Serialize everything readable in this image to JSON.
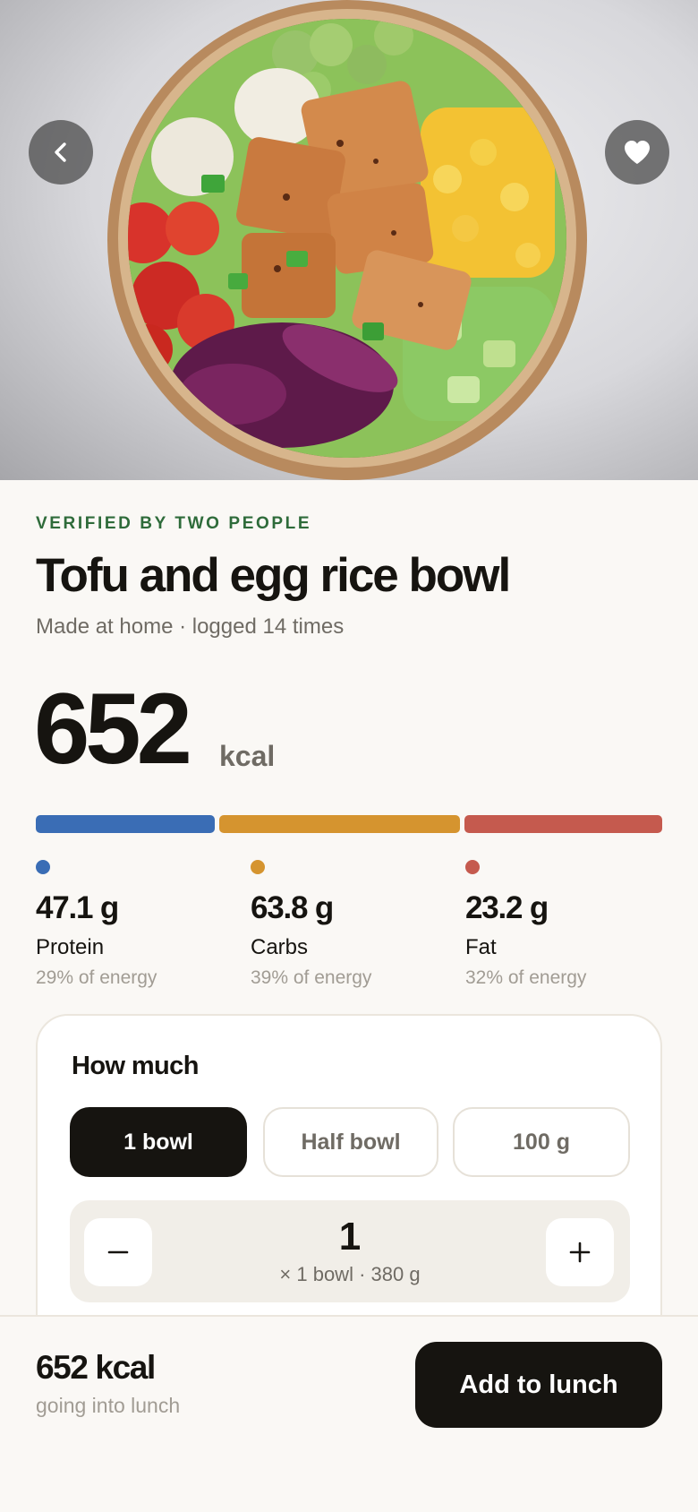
{
  "hero": {
    "photo_icon": "tofu-egg-rice-bowl-photo",
    "back_icon": "chevron-left-icon",
    "favorite_icon": "heart-icon"
  },
  "meal": {
    "verified_label": "VERIFIED BY TWO PEOPLE",
    "title": "Tofu and egg rice bowl",
    "subtitle": "Made at home · logged 14 times",
    "kcal_value": "652",
    "kcal_unit": "kcal"
  },
  "macros": [
    {
      "value": "47.1 g",
      "name": "Protein",
      "energy": "29% of energy",
      "energy_fraction": 0.29,
      "color": "#3a6db5"
    },
    {
      "value": "63.8 g",
      "name": "Carbs",
      "energy": "39% of energy",
      "energy_fraction": 0.39,
      "color": "#d5942f"
    },
    {
      "value": "23.2 g",
      "name": "Fat",
      "energy": "32% of energy",
      "energy_fraction": 0.32,
      "color": "#c55a4e"
    }
  ],
  "portion": {
    "title": "How much",
    "options": [
      "1 bowl",
      "Half bowl",
      "100 g"
    ],
    "selected": "1 bowl",
    "count": "1",
    "detail": "× 1 bowl · 380 g",
    "minus_icon": "minus-icon",
    "plus_icon": "plus-icon"
  },
  "footer": {
    "kcal": "652 kcal",
    "note": "going into lunch",
    "add_label": "Add to lunch"
  },
  "colors": {
    "accent_green": "#2e6b3a",
    "primary_dark": "#161410",
    "background": "#faf8f5"
  }
}
